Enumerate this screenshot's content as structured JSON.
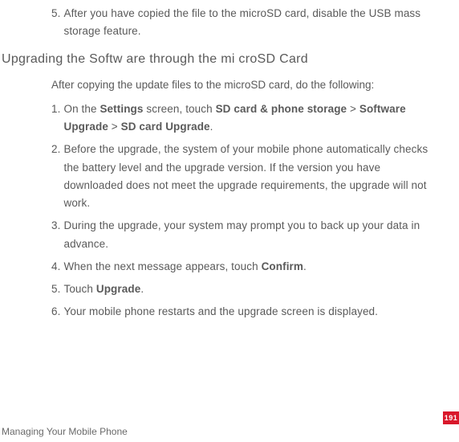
{
  "preSteps": [
    {
      "num": "5.",
      "text": "After you have copied the file to the microSD card, disable the USB mass storage feature."
    }
  ],
  "sectionTitle": "Upgrading the Softw are through the mi croSD Card",
  "intro": "After copying the update files to the microSD card, do the following:",
  "steps": [
    {
      "num": "1.",
      "parts": [
        {
          "t": "On the ",
          "b": false
        },
        {
          "t": "Settings",
          "b": true
        },
        {
          "t": " screen, touch ",
          "b": false
        },
        {
          "t": "SD card & phone storage",
          "b": true
        },
        {
          "t": " > ",
          "b": false
        },
        {
          "t": "Software Upgrade",
          "b": true
        },
        {
          "t": " > ",
          "b": false
        },
        {
          "t": "SD card Upgrade",
          "b": true
        },
        {
          "t": ".",
          "b": false
        }
      ]
    },
    {
      "num": "2.",
      "parts": [
        {
          "t": "Before the upgrade, the system of your mobile phone automatically checks the battery level and the upgrade version. If the version you have downloaded does not meet the upgrade requirements, the upgrade will not work.",
          "b": false
        }
      ]
    },
    {
      "num": "3.",
      "parts": [
        {
          "t": "During the upgrade, your system may prompt you to back up your data in advance.",
          "b": false
        }
      ]
    },
    {
      "num": "4.",
      "parts": [
        {
          "t": "When the next message appears, touch ",
          "b": false
        },
        {
          "t": "Confirm",
          "b": true
        },
        {
          "t": ".",
          "b": false
        }
      ]
    },
    {
      "num": "5.",
      "parts": [
        {
          "t": "Touch ",
          "b": false
        },
        {
          "t": "Upgrade",
          "b": true
        },
        {
          "t": ".",
          "b": false
        }
      ]
    },
    {
      "num": "6.",
      "parts": [
        {
          "t": "Your mobile phone restarts and the upgrade screen is displayed.",
          "b": false
        }
      ]
    }
  ],
  "footer": "Managing Your Mobile Phone",
  "pageNumber": "191"
}
